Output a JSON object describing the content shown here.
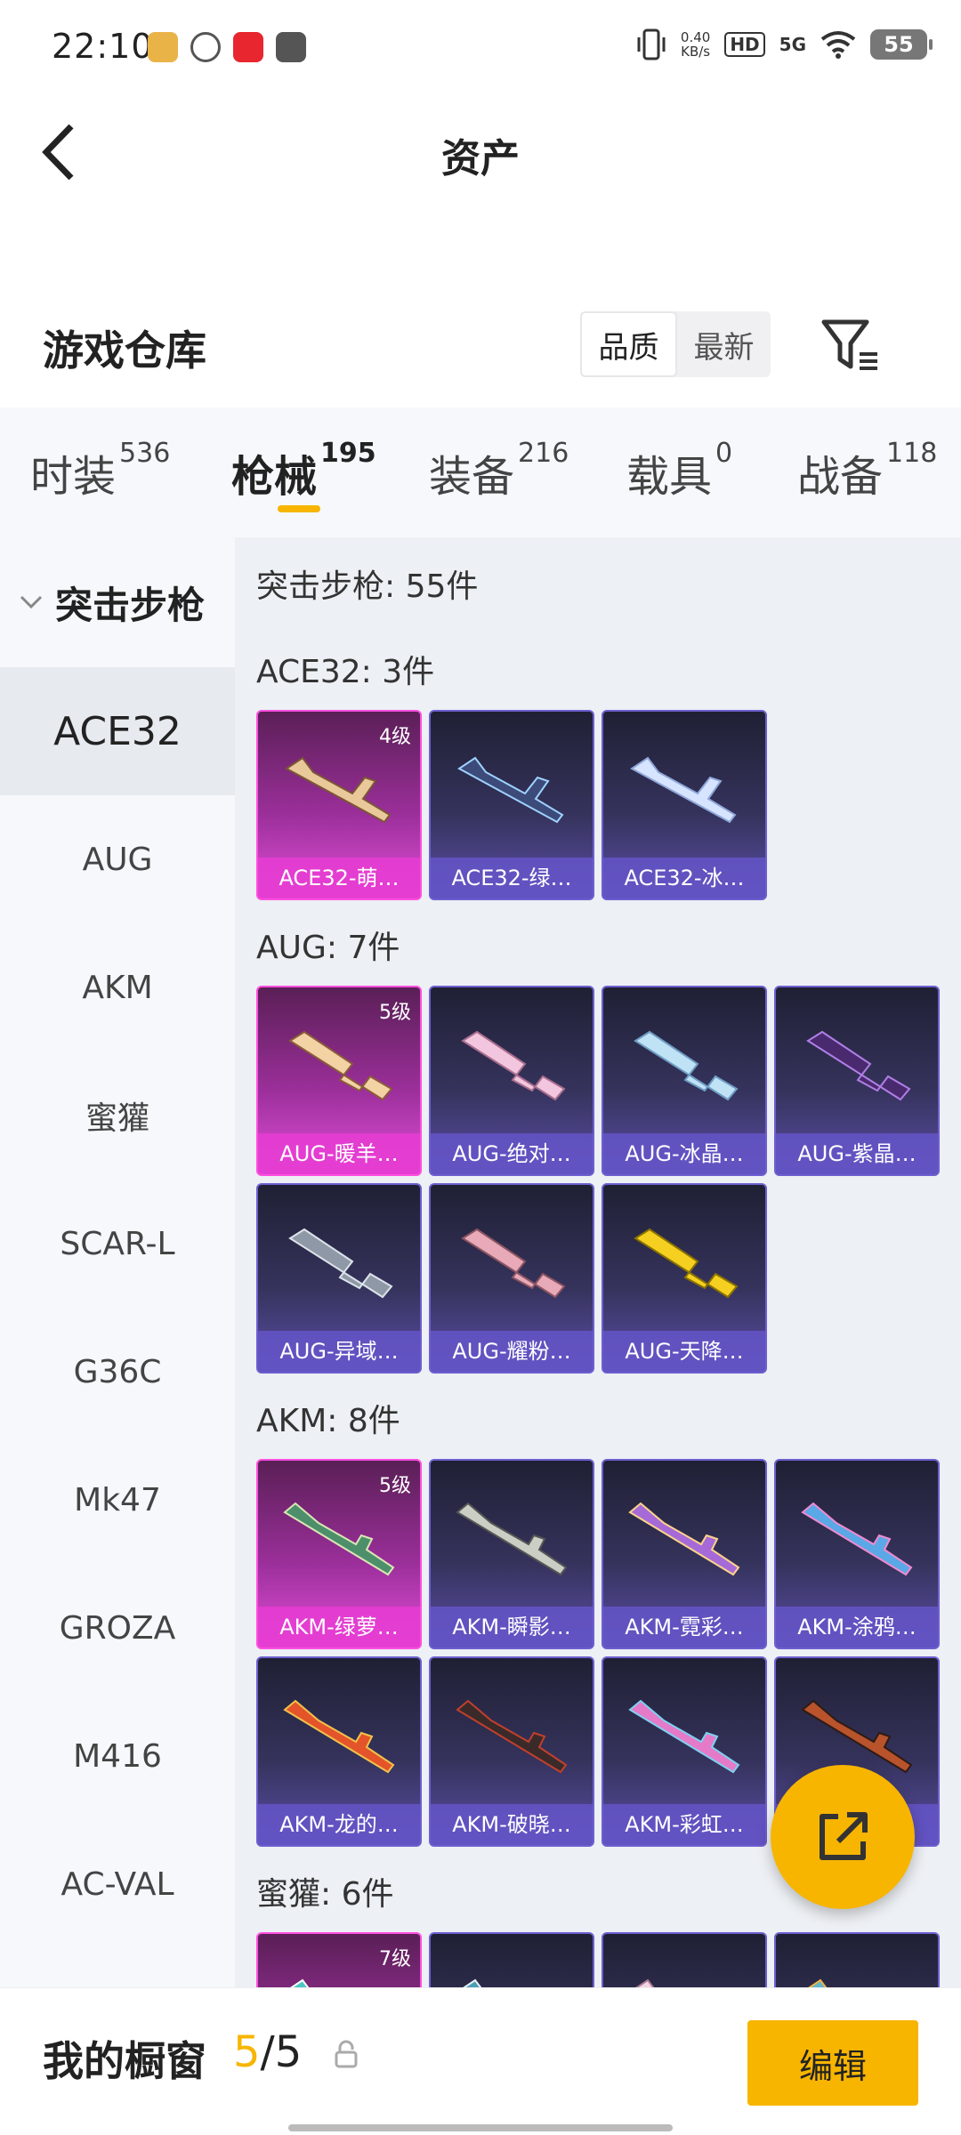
{
  "status_bar": {
    "time": "22:10",
    "net_speed_top": "0.40",
    "net_speed_unit": "KB/s",
    "hd": "HD",
    "signal": "5G",
    "battery": "55"
  },
  "header": {
    "title": "资产"
  },
  "warehouse": {
    "title": "游戏仓库",
    "sort_options": [
      "品质",
      "最新"
    ],
    "active_sort": "品质"
  },
  "tabs": [
    {
      "label": "时装",
      "count": "536"
    },
    {
      "label": "枪械",
      "count": "195"
    },
    {
      "label": "装备",
      "count": "216"
    },
    {
      "label": "载具",
      "count": "0"
    },
    {
      "label": "战备",
      "count": "118"
    }
  ],
  "active_tab": "枪械",
  "sidebar": {
    "category": "突击步枪",
    "items": [
      "ACE32",
      "AUG",
      "AKM",
      "蜜獾",
      "SCAR-L",
      "G36C",
      "Mk47",
      "GROZA",
      "M416",
      "AC-VAL"
    ],
    "active": "ACE32"
  },
  "content": {
    "category_total": "突击步枪: 55件",
    "sections": [
      {
        "title": "ACE32: 3件",
        "cards": [
          {
            "name": "ACE32-萌…",
            "level": "4级",
            "rare": true
          },
          {
            "name": "ACE32-绿…",
            "level": "",
            "rare": false
          },
          {
            "name": "ACE32-冰…",
            "level": "",
            "rare": false
          }
        ]
      },
      {
        "title": "AUG: 7件",
        "cards": [
          {
            "name": "AUG-暖羊…",
            "level": "5级",
            "rare": true
          },
          {
            "name": "AUG-绝对…",
            "level": "",
            "rare": false
          },
          {
            "name": "AUG-冰晶…",
            "level": "",
            "rare": false
          },
          {
            "name": "AUG-紫晶…",
            "level": "",
            "rare": false
          },
          {
            "name": "AUG-异域…",
            "level": "",
            "rare": false
          },
          {
            "name": "AUG-耀粉…",
            "level": "",
            "rare": false
          },
          {
            "name": "AUG-天降…",
            "level": "",
            "rare": false
          }
        ]
      },
      {
        "title": "AKM: 8件",
        "cards": [
          {
            "name": "AKM-绿萝…",
            "level": "5级",
            "rare": true
          },
          {
            "name": "AKM-瞬影…",
            "level": "",
            "rare": false
          },
          {
            "name": "AKM-霓彩…",
            "level": "",
            "rare": false
          },
          {
            "name": "AKM-涂鸦…",
            "level": "",
            "rare": false
          },
          {
            "name": "AKM-龙的…",
            "level": "",
            "rare": false
          },
          {
            "name": "AKM-破晓…",
            "level": "",
            "rare": false
          },
          {
            "name": "AKM-彩虹…",
            "level": "",
            "rare": false
          },
          {
            "name": "",
            "level": "",
            "rare": false
          }
        ]
      },
      {
        "title": "蜜獾: 6件",
        "cards": [
          {
            "name": "",
            "level": "7级",
            "rare": true
          },
          {
            "name": "",
            "level": "",
            "rare": false
          },
          {
            "name": "",
            "level": "",
            "rare": false
          },
          {
            "name": "",
            "level": "",
            "rare": false
          }
        ]
      }
    ]
  },
  "showcase": {
    "title": "我的橱窗",
    "current": "5",
    "total": "/5",
    "edit_label": "编辑"
  },
  "colors": {
    "accent": "#f7b500",
    "card_purple": "#5b4ea8",
    "card_pink": "#e24fd9"
  }
}
